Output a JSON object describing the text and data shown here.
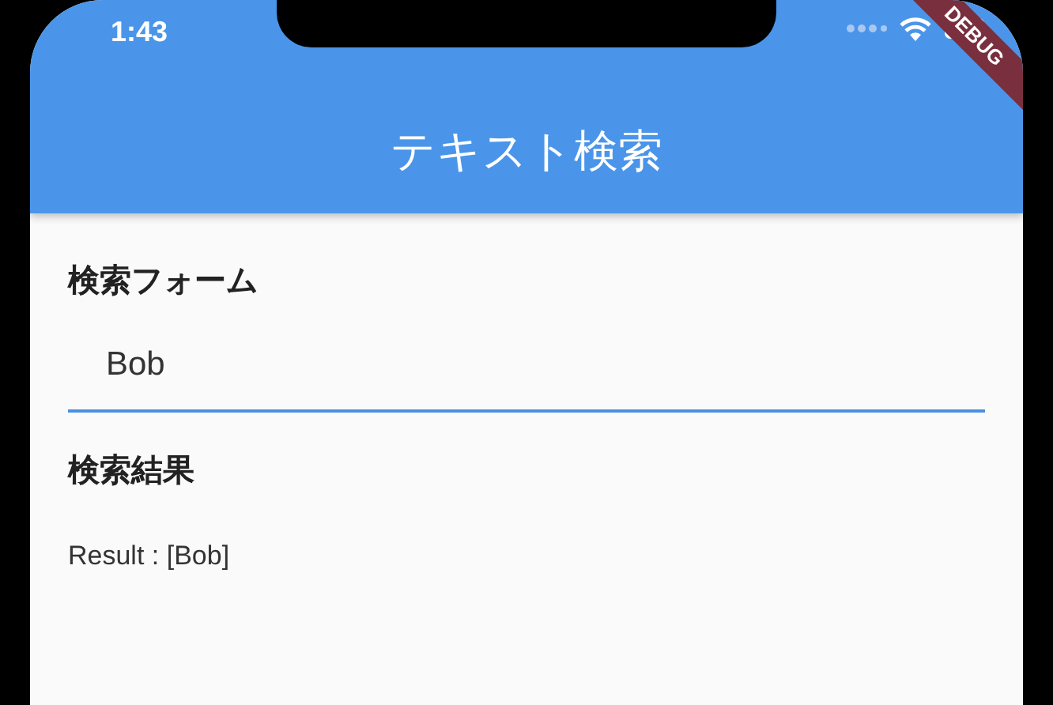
{
  "status_bar": {
    "time": "1:43"
  },
  "app_bar": {
    "title": "テキスト検索"
  },
  "debug_banner": {
    "text": "DEBUG"
  },
  "form": {
    "label": "検索フォーム",
    "value": "Bob",
    "focused": true
  },
  "results": {
    "heading": "検索結果",
    "text": "Result : [Bob]"
  }
}
